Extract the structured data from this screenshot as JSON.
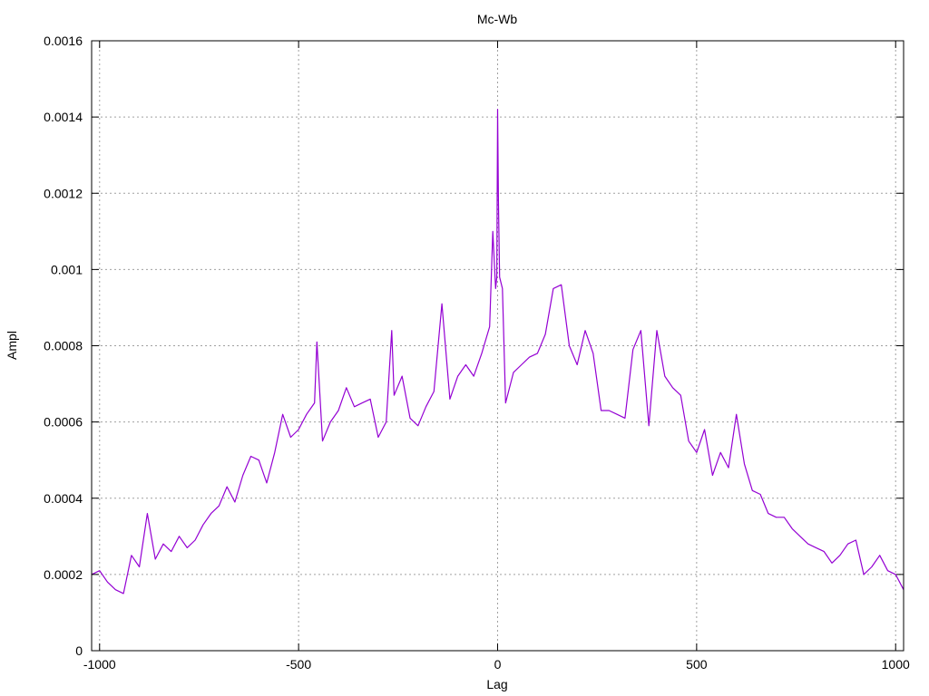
{
  "chart_data": {
    "type": "line",
    "title": "Mc-Wb",
    "xlabel": "Lag",
    "ylabel": "Ampl",
    "xlim": [
      -1020,
      1020
    ],
    "ylim": [
      0,
      0.0016
    ],
    "xticks": [
      -1000,
      -500,
      0,
      500,
      1000
    ],
    "xtick_labels": [
      "-1000",
      "-500",
      "0",
      "500",
      "1000"
    ],
    "yticks": [
      0,
      0.0002,
      0.0004,
      0.0006,
      0.0008,
      0.001,
      0.0012,
      0.0014,
      0.0016
    ],
    "ytick_labels": [
      "0",
      "0.0002",
      "0.0004",
      "0.0006",
      "0.0008",
      "0.001",
      "0.0012",
      "0.0014",
      "0.0016"
    ],
    "grid": true,
    "legend": "none",
    "series": [
      {
        "color": "#9400d3",
        "x": [
          -1020,
          -1000,
          -980,
          -960,
          -940,
          -920,
          -900,
          -880,
          -860,
          -840,
          -820,
          -800,
          -780,
          -760,
          -740,
          -720,
          -700,
          -680,
          -660,
          -640,
          -620,
          -600,
          -580,
          -560,
          -540,
          -520,
          -500,
          -480,
          -460,
          -454,
          -440,
          -420,
          -400,
          -380,
          -360,
          -340,
          -320,
          -300,
          -280,
          -266,
          -260,
          -240,
          -220,
          -200,
          -180,
          -160,
          -140,
          -120,
          -100,
          -80,
          -60,
          -40,
          -20,
          -12,
          -5,
          -2,
          0,
          2,
          5,
          12,
          20,
          40,
          60,
          80,
          100,
          120,
          140,
          160,
          180,
          200,
          220,
          240,
          260,
          280,
          300,
          320,
          340,
          360,
          380,
          400,
          420,
          440,
          460,
          480,
          500,
          520,
          540,
          560,
          580,
          600,
          620,
          640,
          660,
          680,
          700,
          720,
          740,
          760,
          780,
          800,
          820,
          840,
          860,
          880,
          900,
          920,
          940,
          960,
          980,
          1000,
          1020
        ],
        "y": [
          0.0002,
          0.00021,
          0.00018,
          0.00016,
          0.00015,
          0.00025,
          0.00022,
          0.00036,
          0.00024,
          0.00028,
          0.00026,
          0.0003,
          0.00027,
          0.00029,
          0.00033,
          0.00036,
          0.00038,
          0.00043,
          0.00039,
          0.00046,
          0.00051,
          0.0005,
          0.00044,
          0.00052,
          0.00062,
          0.00056,
          0.00058,
          0.00062,
          0.00065,
          0.00081,
          0.00055,
          0.0006,
          0.00063,
          0.00069,
          0.00064,
          0.00065,
          0.00066,
          0.00056,
          0.0006,
          0.00084,
          0.00067,
          0.00072,
          0.00061,
          0.00059,
          0.00064,
          0.00068,
          0.00091,
          0.00066,
          0.00072,
          0.00075,
          0.00072,
          0.00078,
          0.00085,
          0.0011,
          0.00095,
          0.00098,
          0.00142,
          0.00118,
          0.00098,
          0.00095,
          0.00065,
          0.00073,
          0.00075,
          0.00077,
          0.00078,
          0.00083,
          0.00095,
          0.00096,
          0.0008,
          0.00075,
          0.00084,
          0.00078,
          0.00063,
          0.00063,
          0.00062,
          0.00061,
          0.00079,
          0.00084,
          0.00059,
          0.00084,
          0.00072,
          0.00069,
          0.00067,
          0.00055,
          0.00052,
          0.00058,
          0.00046,
          0.00052,
          0.00048,
          0.00062,
          0.00049,
          0.00042,
          0.00041,
          0.00036,
          0.00035,
          0.00035,
          0.00032,
          0.0003,
          0.00028,
          0.00027,
          0.00026,
          0.00023,
          0.00025,
          0.00028,
          0.00029,
          0.0002,
          0.00022,
          0.00025,
          0.00021,
          0.0002,
          0.00016
        ]
      }
    ]
  }
}
